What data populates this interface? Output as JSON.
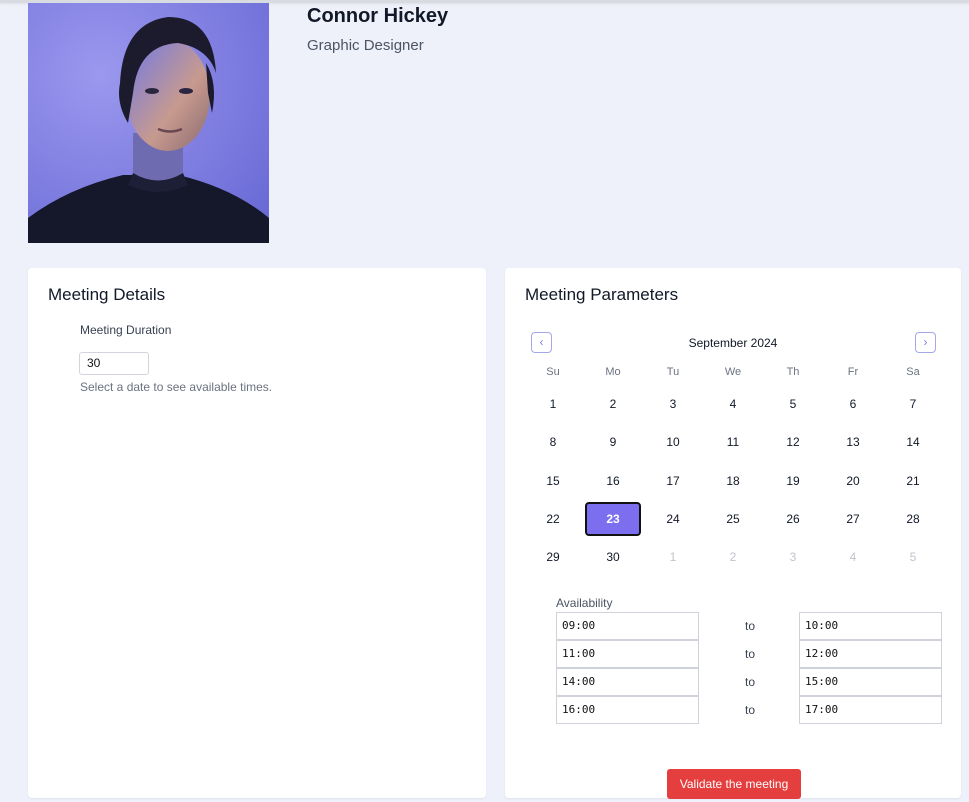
{
  "profile": {
    "name": "Connor Hickey",
    "role": "Graphic Designer"
  },
  "meeting_details": {
    "title": "Meeting Details",
    "duration_label": "Meeting Duration",
    "duration_value": "30",
    "hint": "Select a date to see available times."
  },
  "meeting_parameters": {
    "title": "Meeting Parameters",
    "month": "September 2024",
    "weekdays": [
      "Su",
      "Mo",
      "Tu",
      "We",
      "Th",
      "Fr",
      "Sa"
    ],
    "weeks": [
      [
        "1",
        "2",
        "3",
        "4",
        "5",
        "6",
        "7"
      ],
      [
        "8",
        "9",
        "10",
        "11",
        "12",
        "13",
        "14"
      ],
      [
        "15",
        "16",
        "17",
        "18",
        "19",
        "20",
        "21"
      ],
      [
        "22",
        "23",
        "24",
        "25",
        "26",
        "27",
        "28"
      ],
      [
        "29",
        "30",
        "1",
        "2",
        "3",
        "4",
        "5"
      ]
    ],
    "selected_day": "23",
    "availability_label": "Availability",
    "to_label": "to",
    "slots": [
      {
        "from": "09:00",
        "to": "10:00"
      },
      {
        "from": "11:00",
        "to": "12:00"
      },
      {
        "from": "14:00",
        "to": "15:00"
      },
      {
        "from": "16:00",
        "to": "17:00"
      }
    ],
    "validate_label": "Validate the meeting"
  },
  "colors": {
    "accent": "#7b6ff0",
    "danger": "#e53e3e",
    "background": "#eef0fa"
  }
}
